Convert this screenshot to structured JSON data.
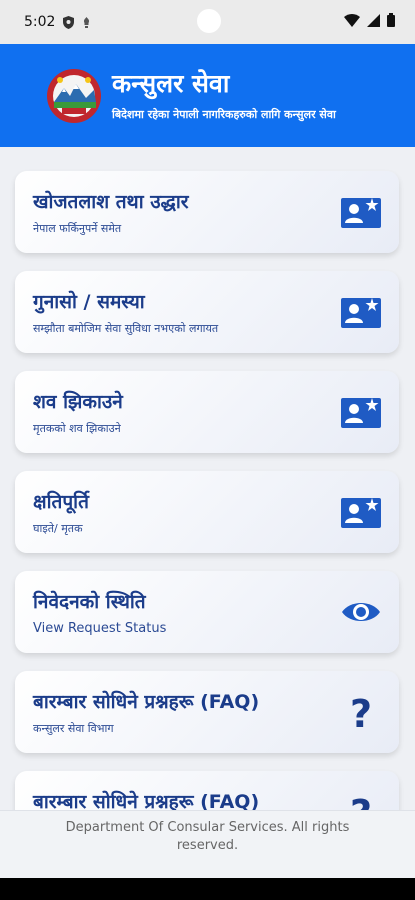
{
  "status_bar": {
    "time": "5:02"
  },
  "header": {
    "title": "कन्सुलर सेवा",
    "subtitle": "बिदेशमा रहेका नेपाली नागरिकहरुको लागि कन्सुलर सेवा"
  },
  "cards": [
    {
      "title": "खोजतलाश तथा उद्धार",
      "subtitle": "नेपाल फर्किनुपर्ने समेत",
      "icon": "contact-card-icon"
    },
    {
      "title": "गुनासो / समस्या",
      "subtitle": "सम्झौता बमोजिम सेवा सुविधा नभएको लगायत",
      "icon": "contact-card-icon"
    },
    {
      "title": "शव झिकाउने",
      "subtitle": "मृतकको शव झिकाउने",
      "icon": "contact-card-icon"
    },
    {
      "title": "क्षतिपूर्ति",
      "subtitle": "घाइते/ मृतक",
      "icon": "contact-card-icon"
    },
    {
      "title": "निवेदनको स्थिति",
      "subtitle": "View Request Status",
      "icon": "eye-icon"
    },
    {
      "title": "बारम्बार सोधिने प्रश्नहरू (FAQ)",
      "subtitle": "कन्सुलर सेवा विभाग",
      "icon": "question-icon"
    },
    {
      "title": "बारम्बार सोधिने प्रश्नहरू (FAQ)",
      "subtitle": "",
      "icon": "question-icon"
    }
  ],
  "footer": {
    "text": "Department Of Consular Services. All rights reserved."
  },
  "colors": {
    "header": "#1070f0",
    "card_text": "#1b3c8a",
    "icon": "#1f5bc4"
  }
}
